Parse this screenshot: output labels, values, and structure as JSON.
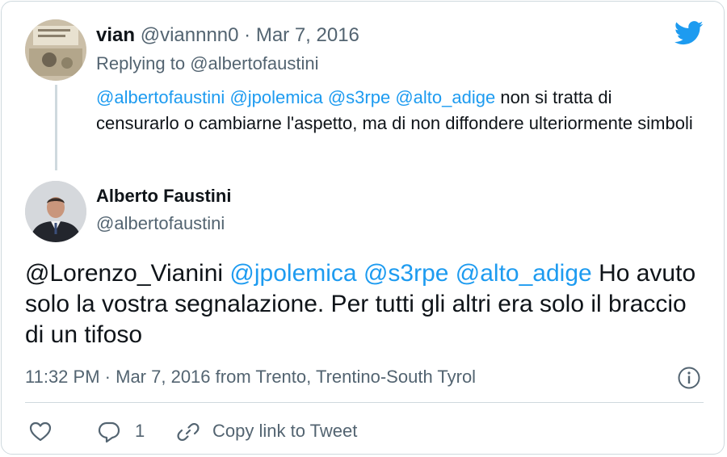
{
  "reply_tweet": {
    "author_name": "vian",
    "author_handle": "@viannnn0",
    "separator": "·",
    "date": "Mar 7, 2016",
    "replying_prefix": "Replying to",
    "replying_handle": "@albertofaustini",
    "mentions": [
      "@albertofaustini",
      "@jpolemica",
      "@s3rpe",
      "@alto_adige"
    ],
    "text": "non si tratta di censurarlo o cambiarne l'aspetto, ma di non diffondere ulteriormente simboli"
  },
  "main_tweet": {
    "author_name": "Alberto Faustini",
    "author_handle": "@albertofaustini",
    "leading_mention": "@Lorenzo_Vianini",
    "mentions": [
      "@jpolemica",
      "@s3rpe",
      "@alto_adige"
    ],
    "text": "Ho avuto solo la vostra segnalazione. Per tutti gli altri era solo il braccio di un tifoso",
    "time": "11:32 PM",
    "separator": "·",
    "date": "Mar 7, 2016",
    "location": "from Trento, Trentino-South Tyrol"
  },
  "actions": {
    "reply_count": "1",
    "copy_link_label": "Copy link to Tweet"
  },
  "colors": {
    "link": "#1d9bf0",
    "muted": "#536471",
    "text": "#0f1419",
    "border": "#cfd9de"
  },
  "icons": [
    "twitter-bird-icon",
    "info-icon",
    "heart-icon",
    "reply-icon",
    "link-icon"
  ]
}
